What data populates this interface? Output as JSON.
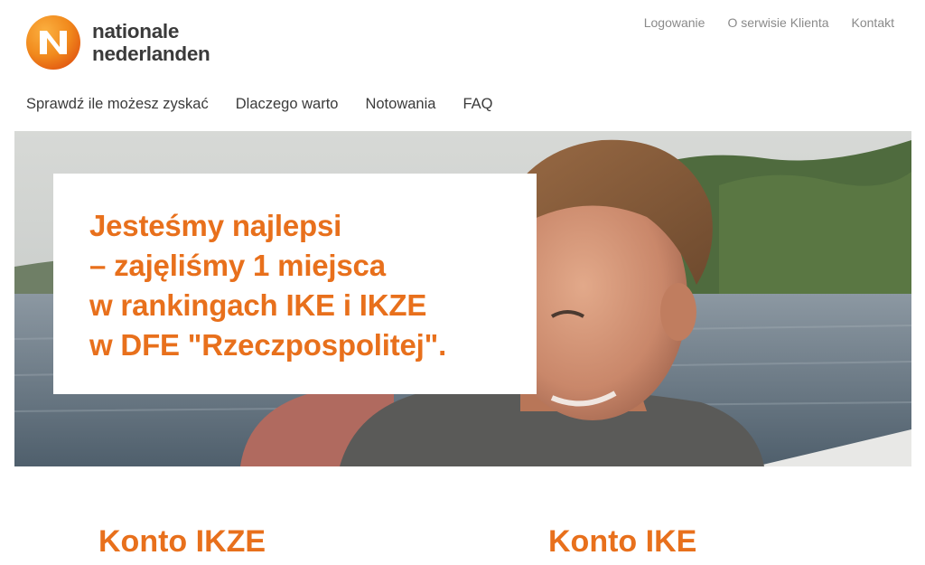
{
  "header": {
    "logo_line1": "nationale",
    "logo_line2": "nederlanden",
    "utility_links": [
      "Logowanie",
      "O serwisie Klienta",
      "Kontakt"
    ]
  },
  "nav": {
    "items": [
      "Sprawdź ile możesz zyskać",
      "Dlaczego warto",
      "Notowania",
      "FAQ"
    ]
  },
  "hero": {
    "lines": [
      "Jesteśmy najlepsi",
      "– zajęliśmy 1 miejsca",
      "w rankingach IKE i IKZE",
      "w DFE \"Rzeczpospolitej\"."
    ]
  },
  "products": {
    "ikze_title": "Konto IKZE",
    "ike_title": "Konto IKE"
  },
  "colors": {
    "brand_orange": "#e8701c",
    "text_dark": "#3b3b3b",
    "text_muted": "#8a8a8a"
  },
  "icons": {
    "logo": "nn-logo-icon"
  }
}
